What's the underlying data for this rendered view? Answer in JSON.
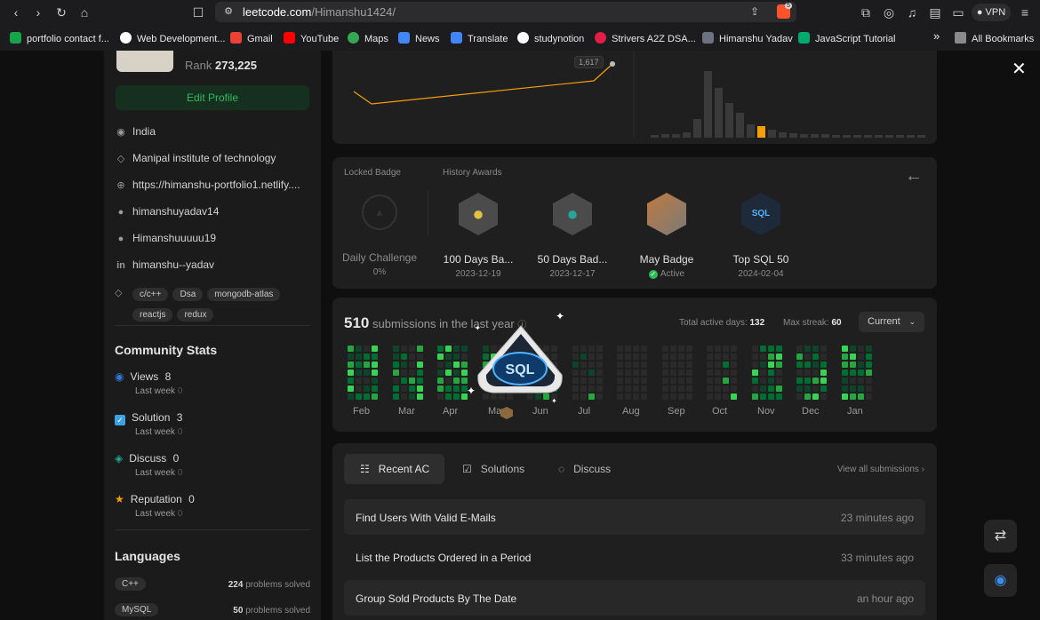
{
  "browser": {
    "url_host": "leetcode.com",
    "url_path": "/Himanshu1424/",
    "vpn_label": "VPN",
    "shield_count": "5",
    "bookmarks": [
      {
        "label": "portfolio contact f...",
        "color": "#16a34a"
      },
      {
        "label": "Web Development...",
        "color": "#ffffff"
      },
      {
        "label": "Gmail",
        "color": "#ea4335"
      },
      {
        "label": "YouTube",
        "color": "#ff0000"
      },
      {
        "label": "Maps",
        "color": "#34a853"
      },
      {
        "label": "News",
        "color": "#4285f4"
      },
      {
        "label": "Translate",
        "color": "#4285f4"
      },
      {
        "label": "studynotion",
        "color": "#ffffff"
      },
      {
        "label": "Strivers A2Z DSA...",
        "color": "#e11d48"
      },
      {
        "label": "Himanshu Yadav",
        "color": "#6b7280"
      },
      {
        "label": "JavaScript Tutorial",
        "color": "#04aa6d"
      }
    ],
    "all_bookmarks": "All Bookmarks",
    "overflow": "»"
  },
  "profile": {
    "rank_label": "Rank",
    "rank_value": "273,225",
    "edit_profile": "Edit Profile",
    "location": "India",
    "school": "Manipal institute of technology",
    "website": "https://himanshu-portfolio1.netlify....",
    "github": "himanshuyadav14",
    "twitter": "Himanshuuuuu19",
    "linkedin": "himanshu--yadav",
    "skills": [
      "c/c++",
      "Dsa",
      "mongodb-atlas",
      "reactjs",
      "redux"
    ]
  },
  "community": {
    "title": "Community Stats",
    "stats": [
      {
        "label": "Views",
        "value": "8",
        "sub": "Last week",
        "delta": "0"
      },
      {
        "label": "Solution",
        "value": "3",
        "sub": "Last week",
        "delta": "0"
      },
      {
        "label": "Discuss",
        "value": "0",
        "sub": "Last week",
        "delta": "0"
      },
      {
        "label": "Reputation",
        "value": "0",
        "sub": "Last week",
        "delta": "0"
      }
    ]
  },
  "languages": {
    "title": "Languages",
    "items": [
      {
        "name": "C++",
        "count": "224",
        "suffix": "problems solved"
      },
      {
        "name": "MySQL",
        "count": "50",
        "suffix": "problems solved"
      }
    ]
  },
  "contest": {
    "rating_tag": "1,617"
  },
  "badges": {
    "locked_label": "Locked Badge",
    "history_label": "History Awards",
    "locked": {
      "name": "Daily Challenge",
      "progress": "0%"
    },
    "items": [
      {
        "name": "100 Days Ba...",
        "date": "2023-12-19"
      },
      {
        "name": "50 Days Bad...",
        "date": "2023-12-17"
      },
      {
        "name": "May Badge",
        "date": "Active"
      },
      {
        "name": "Top SQL 50",
        "date": "2024-02-04"
      }
    ],
    "popup_badge_text": "SQL"
  },
  "submissions": {
    "count": "510",
    "label": "submissions in the last year",
    "active_days_label": "Total active days:",
    "active_days": "132",
    "streak_label": "Max streak:",
    "streak": "60",
    "range": "Current",
    "months": [
      "Feb",
      "Mar",
      "Apr",
      "May",
      "Jun",
      "Jul",
      "Aug",
      "Sep",
      "Oct",
      "Nov",
      "Dec",
      "Jan"
    ]
  },
  "recent": {
    "tabs": [
      "Recent AC",
      "Solutions",
      "Discuss"
    ],
    "view_all": "View all submissions",
    "rows": [
      {
        "title": "Find Users With Valid E-Mails",
        "time": "23 minutes ago"
      },
      {
        "title": "List the Products Ordered in a Period",
        "time": "33 minutes ago"
      },
      {
        "title": "Group Sold Products By The Date",
        "time": "an hour ago"
      }
    ]
  },
  "colors": {
    "accent_green": "#2cbb5d",
    "accent_orange": "#f59e0b",
    "heat_levels": [
      "#2a2a2a",
      "#0e4429",
      "#006d32",
      "#26a641",
      "#39d353"
    ]
  }
}
